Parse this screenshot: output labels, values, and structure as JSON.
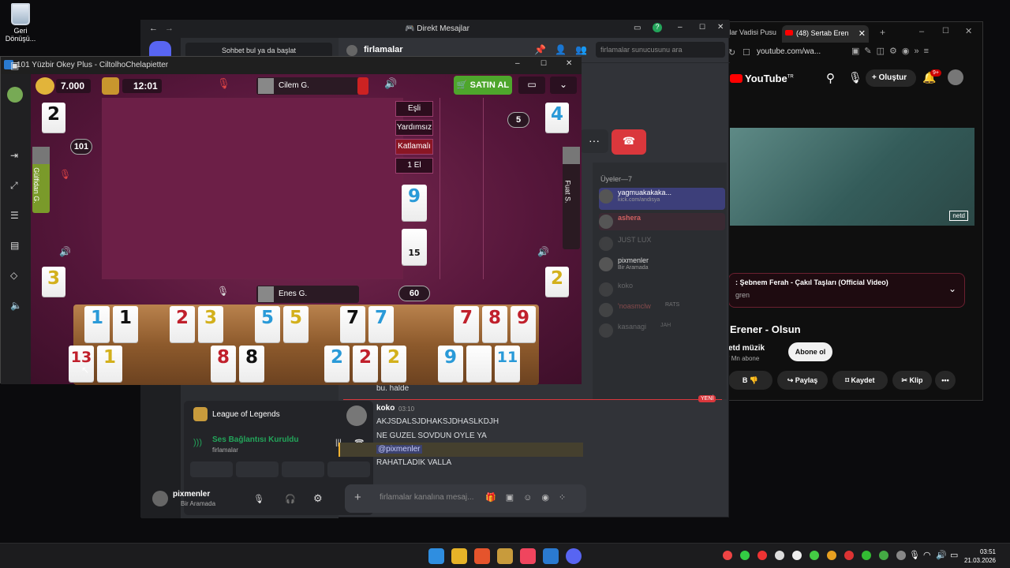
{
  "desktop": {
    "recycle_bin": "Geri Dönüşü..."
  },
  "taskbar": {
    "time": "03:51",
    "date": "21.03.2026"
  },
  "browser": {
    "tab_prev": "rtlar Vadisi Pusu",
    "tab_active": "(48) Sertab Eren",
    "url": "youtube.com/wa...",
    "logo": "YouTube",
    "logo_sup": "TR",
    "create_btn": "Oluştur",
    "notif_badge": "9+",
    "now_playing": ": Şebnem Ferah - Çakıl Taşları (Official Video)",
    "now_playing_sub": "gren",
    "video_title": "Erener - Olsun",
    "channel": "etd müzik",
    "subs": "' Mn abone",
    "subscribe_btn": "Abone ol",
    "actions": {
      "dislike_prefix": "B",
      "share": "Paylaş",
      "save": "Kaydet",
      "clip": "Klip"
    },
    "watermark": "netd"
  },
  "discord": {
    "window_title": "Direkt Mesajlar",
    "search_btn": "Sohbet bul ya da başlat",
    "channel_name": "firlamalar",
    "server_search_placeholder": "firlamalar sunucusunu ara",
    "members_header": "Üyeler—7",
    "members": [
      {
        "name": "yagmuakakaka...",
        "status": "kick.com/andisya"
      },
      {
        "name": "ashera",
        "status": ""
      },
      {
        "name": "JUST LUX",
        "status": ""
      },
      {
        "name": "pixmenler",
        "status": "Bir Aramada"
      },
      {
        "name": "koko",
        "status": ""
      },
      {
        "name": "'noasmclw",
        "status": "RATS"
      },
      {
        "name": "kasanagi",
        "status": "JAH"
      }
    ],
    "game_activity": "League of Legends",
    "voice_status": "Ses Bağlantısı Kuruldu",
    "voice_channel": "firlamalar",
    "user_name": "pixmenler",
    "user_status": "Bir Aramada",
    "prev_msg": "bu. halde",
    "new_label": "YENİ",
    "msg_author": "koko",
    "msg_time": "03:10",
    "messages": [
      "AKJSDALSJDHAKSJDHASLKDJH",
      "NE GUZEL SOVDUN OYLE YA",
      "@pixmenler",
      "RAHATLADIK VALLA"
    ],
    "composer_placeholder": "firlamalar kanalına mesaj..."
  },
  "game": {
    "title": "101 Yüzbir Okey Plus - CiltolhoChelapietter",
    "chips": "7.000",
    "timer": "12:01",
    "buy_btn": "SATIN AL",
    "players": {
      "top": "Cilem G.",
      "left": "Gülfidan G.",
      "right": "Fuat S.",
      "bottom": "Enes G."
    },
    "modes": [
      "Eşli",
      "Yardımsız",
      "Katlamalı",
      "1 El"
    ],
    "selected_mode": "Katlamalı",
    "left_count": "101",
    "right_count": "5",
    "rack_count": "60",
    "discards": {
      "top_left": "2",
      "top_right": "4",
      "left": "3",
      "right": "2"
    },
    "indicator_tile": "9",
    "deck_count": "15",
    "rack_top": [
      {
        "v": "1",
        "c": "blue"
      },
      {
        "v": "1",
        "c": "black"
      },
      {
        "v": "",
        "c": ""
      },
      {
        "v": "2",
        "c": "red"
      },
      {
        "v": "3",
        "c": "yellow"
      },
      {
        "v": "",
        "c": ""
      },
      {
        "v": "5",
        "c": "blue"
      },
      {
        "v": "5",
        "c": "yellow"
      },
      {
        "v": "",
        "c": ""
      },
      {
        "v": "7",
        "c": "black"
      },
      {
        "v": "7",
        "c": "blue"
      },
      {
        "v": "",
        "c": ""
      },
      {
        "v": "",
        "c": ""
      },
      {
        "v": "7",
        "c": "red"
      },
      {
        "v": "8",
        "c": "red"
      },
      {
        "v": "9",
        "c": "red"
      }
    ],
    "rack_bottom": [
      {
        "v": "13",
        "c": "red"
      },
      {
        "v": "1",
        "c": "yellow"
      },
      {
        "v": "",
        "c": ""
      },
      {
        "v": "",
        "c": ""
      },
      {
        "v": "",
        "c": ""
      },
      {
        "v": "8",
        "c": "red"
      },
      {
        "v": "8",
        "c": "black"
      },
      {
        "v": "",
        "c": ""
      },
      {
        "v": "",
        "c": ""
      },
      {
        "v": "2",
        "c": "blue"
      },
      {
        "v": "2",
        "c": "red"
      },
      {
        "v": "2",
        "c": "yellow"
      },
      {
        "v": "",
        "c": ""
      },
      {
        "v": "9",
        "c": "blue"
      },
      {
        "v": "",
        "c": "blank"
      },
      {
        "v": "11",
        "c": "blue"
      }
    ]
  }
}
